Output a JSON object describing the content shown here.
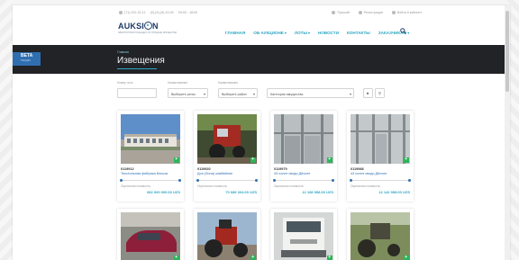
{
  "topbar": {
    "phone": "(71) 202-31-11",
    "phone2": "(0)-(9)-(9)-10-00",
    "hours": "09:00 - 18:00",
    "lang": "Русский",
    "register": "Регистрация",
    "login": "Войти в кабинет"
  },
  "logo": {
    "name_a": "AUKSI",
    "name_b": "N",
    "subtitle": "ЭЛЕКТРОННАЯ ПЛОЩАДКА ПО ПРОДАЖЕ ИМУЩЕСТВА"
  },
  "nav": {
    "items": [
      {
        "label": "ГЛАВНАЯ",
        "dropdown": false
      },
      {
        "label": "ОБ АУКЦИОНЕ",
        "dropdown": true
      },
      {
        "label": "ЛОТЫ",
        "dropdown": true
      },
      {
        "label": "НОВОСТИ",
        "dropdown": false
      },
      {
        "label": "КОНТАКТЫ",
        "dropdown": false
      },
      {
        "label": "ЗАКАЗЧИКАМ",
        "dropdown": true
      }
    ]
  },
  "banner": {
    "beta_title": "BETA",
    "beta_sub": "TALQIN",
    "breadcrumb": "Главная",
    "title": "Извещения"
  },
  "filters": {
    "lot_label": "Номер лота",
    "region_label": "Наименование",
    "district_label": "Наименование",
    "region_value": "Выберите регио",
    "district_value": "Выберите район",
    "category_value": "Категория имущества",
    "arrow_btn": "►",
    "search_btn": "⚲"
  },
  "cards": [
    {
      "lot": "0119912",
      "name": "Текстильная фабрика Бекоза",
      "estimate_label": "Оценочная стоимость:",
      "price": "682 000 000.00 UZS",
      "progress": 0.02
    },
    {
      "lot": "0119920",
      "name": "Дон (Зона) комбайнне",
      "estimate_label": "Оценочная стоимость:",
      "price": "70 689 304.00 UZS",
      "progress": 0.02
    },
    {
      "lot": "0119979",
      "name": "43 солит сводо Дёссне",
      "estimate_label": "Оценочная стоимость:",
      "price": "12 168 998.00 UZS",
      "progress": 0.02
    },
    {
      "lot": "0119988",
      "name": "43 солит сводо Дёссне",
      "estimate_label": "Оценочная стоимость:",
      "price": "12 142 998.00 UZS",
      "progress": 0.02
    }
  ],
  "colors": {
    "accent": "#2fa7c2",
    "brand": "#1d3a66",
    "banner": "#212326",
    "beta": "#2f6fb0",
    "plus": "#2fb45a"
  }
}
